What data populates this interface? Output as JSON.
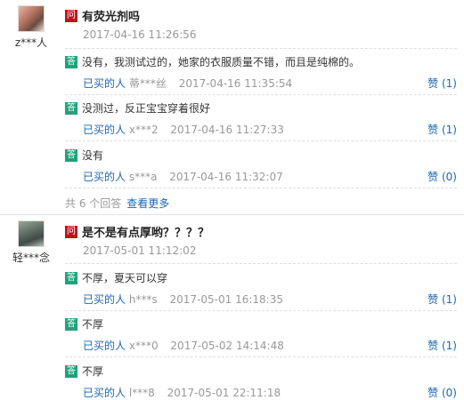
{
  "questions": [
    {
      "user": "z***人",
      "title": "有荧光剂吗",
      "time": "2017-04-16 11:26:56",
      "answers": [
        {
          "text": "没有，我测试过的，她家的衣服质量不错，而且是纯棉的。",
          "buyer": "已买的人",
          "name": "蒂***丝",
          "time": "2017-04-16 11:35:54",
          "like": "赞 (1)"
        },
        {
          "text": "没测过，反正宝宝穿着很好",
          "buyer": "已买的人",
          "name": "x***2",
          "time": "2017-04-16 11:27:33",
          "like": "赞 (1)"
        },
        {
          "text": "没有",
          "buyer": "已买的人",
          "name": "s***a",
          "time": "2017-04-16 11:32:07",
          "like": "赞 (0)"
        }
      ],
      "more_prefix": "共 6 个回答",
      "more_link": "查看更多"
    },
    {
      "user": "轻***念",
      "title": "是不是有点厚哟？？？？",
      "time": "2017-05-01 11:12:02",
      "answers": [
        {
          "text": "不厚，夏天可以穿",
          "buyer": "已买的人",
          "name": "h***s",
          "time": "2017-05-01 16:18:35",
          "like": "赞 (1)"
        },
        {
          "text": "不厚",
          "buyer": "已买的人",
          "name": "x***0",
          "time": "2017-05-02 14:14:48",
          "like": "赞 (1)"
        },
        {
          "text": "不厚",
          "buyer": "已买的人",
          "name": "l***8",
          "time": "2017-05-01 22:11:18",
          "like": "赞 (0)"
        }
      ]
    }
  ],
  "labels": {
    "q": "问",
    "a": "答"
  }
}
